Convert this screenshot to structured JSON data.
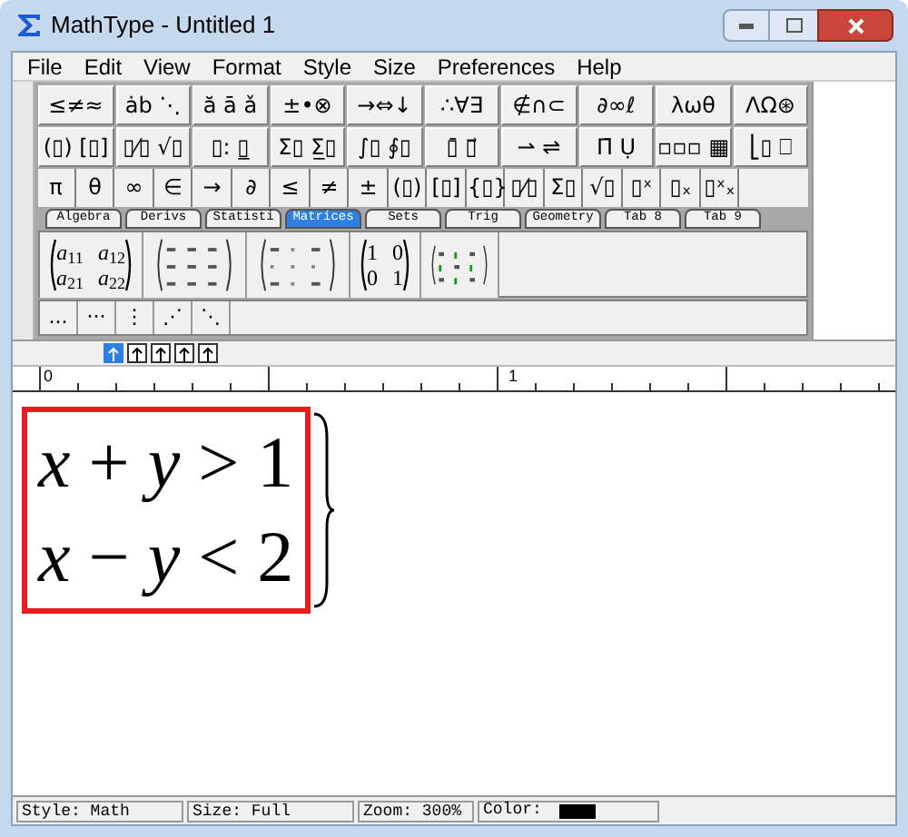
{
  "window": {
    "title": "MathType - Untitled 1"
  },
  "menu": [
    "File",
    "Edit",
    "View",
    "Format",
    "Style",
    "Size",
    "Preferences",
    "Help"
  ],
  "palette_rows": [
    [
      "≤≠≈",
      "ȧb ⋱",
      "ă ā ǎ",
      "±•⊗",
      "→⇔↓",
      "∴∀∃",
      "∉∩⊂",
      "∂∞ℓ",
      "λωθ",
      "ΛΩ⊛"
    ],
    [
      "(▯) [▯]",
      "▯⁄▯ √▯",
      "▯: ▯̲",
      "Σ▯ Σ̲▯",
      "∫▯ ∮▯",
      "▯̄ ▯⃗",
      "⇀ ⇌",
      "Π̄ Ụ",
      "▫▫▫ ▦",
      "⎣▯ ⎕"
    ]
  ],
  "symbol_row": [
    "π",
    "θ",
    "∞",
    "∈",
    "→",
    "∂",
    "≤",
    "≠",
    "±",
    "(▯)",
    "[▯]",
    "{▯}",
    "▯⁄▯",
    "Σ▯",
    "√▯",
    "▯ˣ",
    "▯ₓ",
    "▯ˣₓ"
  ],
  "tabs": [
    {
      "label": "Algebra",
      "selected": false
    },
    {
      "label": "Derivs",
      "selected": false
    },
    {
      "label": "Statisti",
      "selected": false
    },
    {
      "label": "Matrices",
      "selected": true
    },
    {
      "label": "Sets",
      "selected": false
    },
    {
      "label": "Trig",
      "selected": false
    },
    {
      "label": "Geometry",
      "selected": false
    },
    {
      "label": "Tab 8",
      "selected": false
    },
    {
      "label": "Tab 9",
      "selected": false
    }
  ],
  "templates": [
    {
      "kind": "matrix",
      "rows": [
        [
          "*a*$_{11}$",
          "*a*$_{12}$"
        ],
        [
          "*a*$_{21}$",
          "*a*$_{22}$"
        ]
      ]
    },
    {
      "kind": "grid"
    },
    {
      "kind": "general"
    },
    {
      "kind": "matrix",
      "rows": [
        [
          "1",
          "0"
        ],
        [
          "0",
          "1"
        ]
      ]
    },
    {
      "kind": "sparse"
    }
  ],
  "dots": [
    "...",
    "···",
    "⋮",
    "⋰",
    "⋱"
  ],
  "nudge_tools": [
    {
      "selected": true
    },
    {
      "selected": false
    },
    {
      "selected": false
    },
    {
      "selected": false
    },
    {
      "selected": false
    }
  ],
  "ruler": {
    "labels": [
      "0",
      "1"
    ]
  },
  "equation": {
    "lines": [
      "*x* + *y* > 1",
      "*x* − *y* < 2"
    ],
    "highlighted": true
  },
  "status_bar": [
    {
      "kind": "text",
      "text": "Style: Math"
    },
    {
      "kind": "text",
      "text": "Size: Full"
    },
    {
      "kind": "text",
      "text": "Zoom: 300%"
    },
    {
      "kind": "color",
      "text": "Color:",
      "color": "#000000"
    }
  ]
}
